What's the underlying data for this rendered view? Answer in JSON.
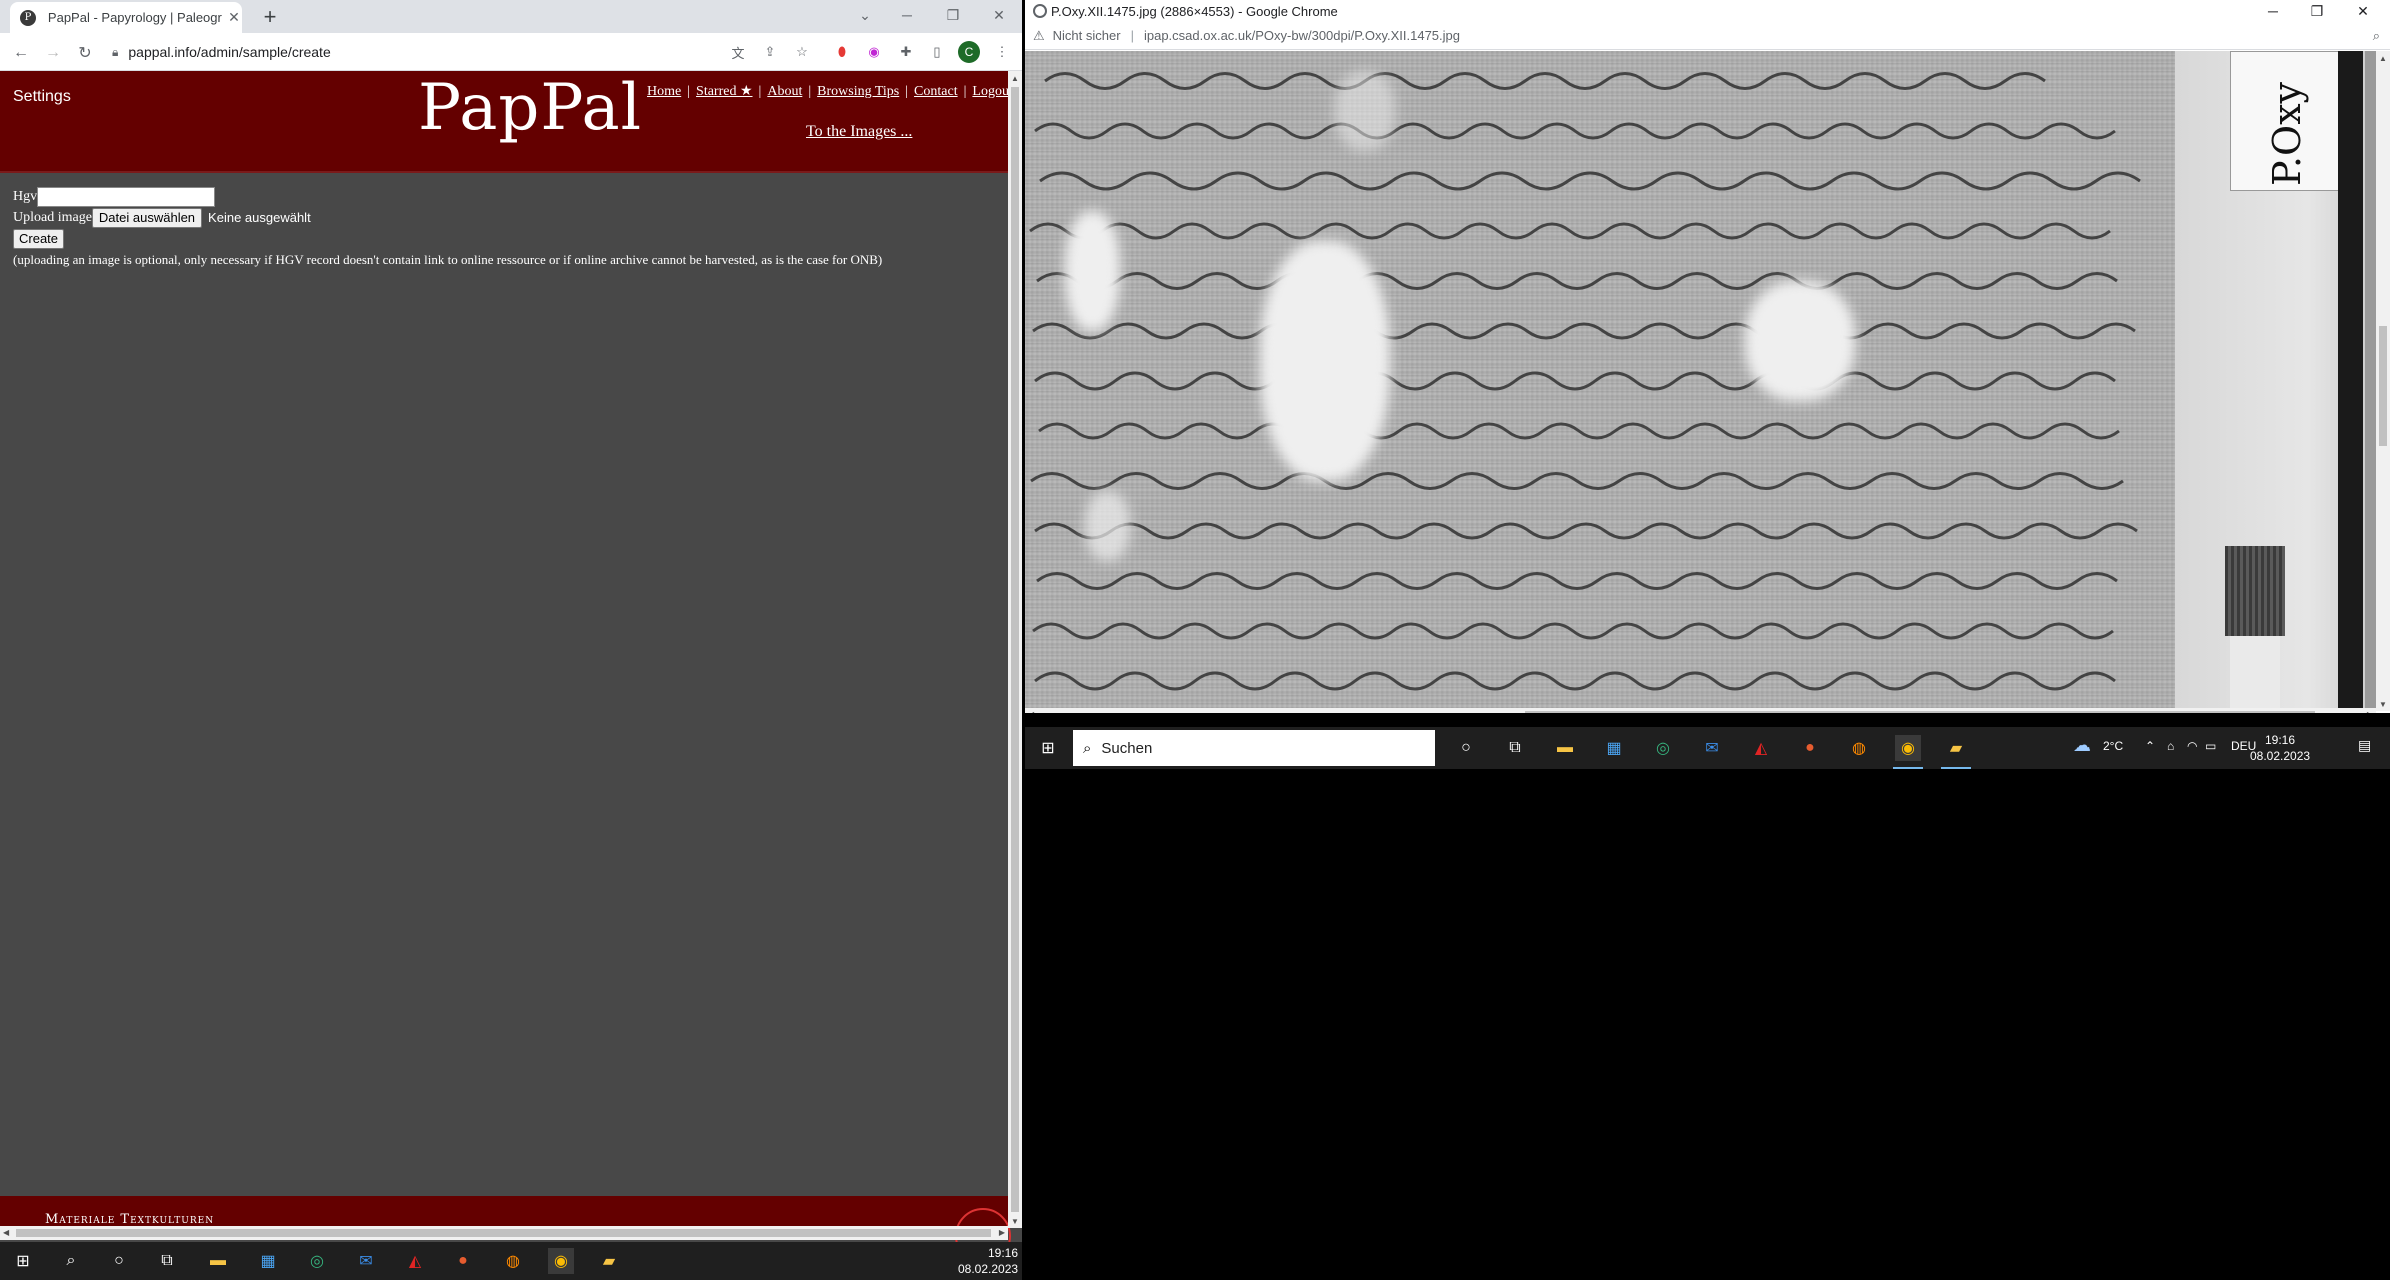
{
  "left_browser": {
    "tab": {
      "title": "PapPal - Papyrology | Paleograph",
      "favicon_letter": "P"
    },
    "address": {
      "url": "pappal.info/admin/sample/create"
    },
    "profile_letter": "C",
    "window_controls": {
      "minimize": "─",
      "restore": "❐",
      "close": "✕"
    }
  },
  "site": {
    "settings": "Settings",
    "logo": "PapPal",
    "nav": [
      {
        "label": "Home"
      },
      {
        "label": "Starred ★"
      },
      {
        "label": "About"
      },
      {
        "label": "Browsing Tips"
      },
      {
        "label": "Contact"
      },
      {
        "label": "Logout"
      }
    ],
    "to_images": "To the Images ...",
    "footer_text": "Materiale Textkulturen"
  },
  "form": {
    "hgv_label": "Hgv",
    "hgv_value": "",
    "upload_label": "Upload image",
    "file_button": "Datei auswählen",
    "file_status": "Keine ausgewählt",
    "create_button": "Create",
    "hint": "(uploading an image is optional, only necessary if HGV record doesn't contain link to online ressource or if online archive cannot be harvested, as is the case for ONB)"
  },
  "left_taskbar": {
    "time": "19:16",
    "date": "08.02.2023"
  },
  "right_browser": {
    "window_title": "P.Oxy.XII.1475.jpg (2886×4553) - Google Chrome",
    "not_secure": "Nicht sicher",
    "url": "ipap.csad.ox.ac.uk/POxy-bw/300dpi/P.Oxy.XII.1475.jpg",
    "image_label": "P.Oxy"
  },
  "right_taskbar": {
    "search_placeholder": "Suchen",
    "weather": "2°C",
    "language": "DEU",
    "time": "19:16",
    "date": "08.02.2023"
  }
}
